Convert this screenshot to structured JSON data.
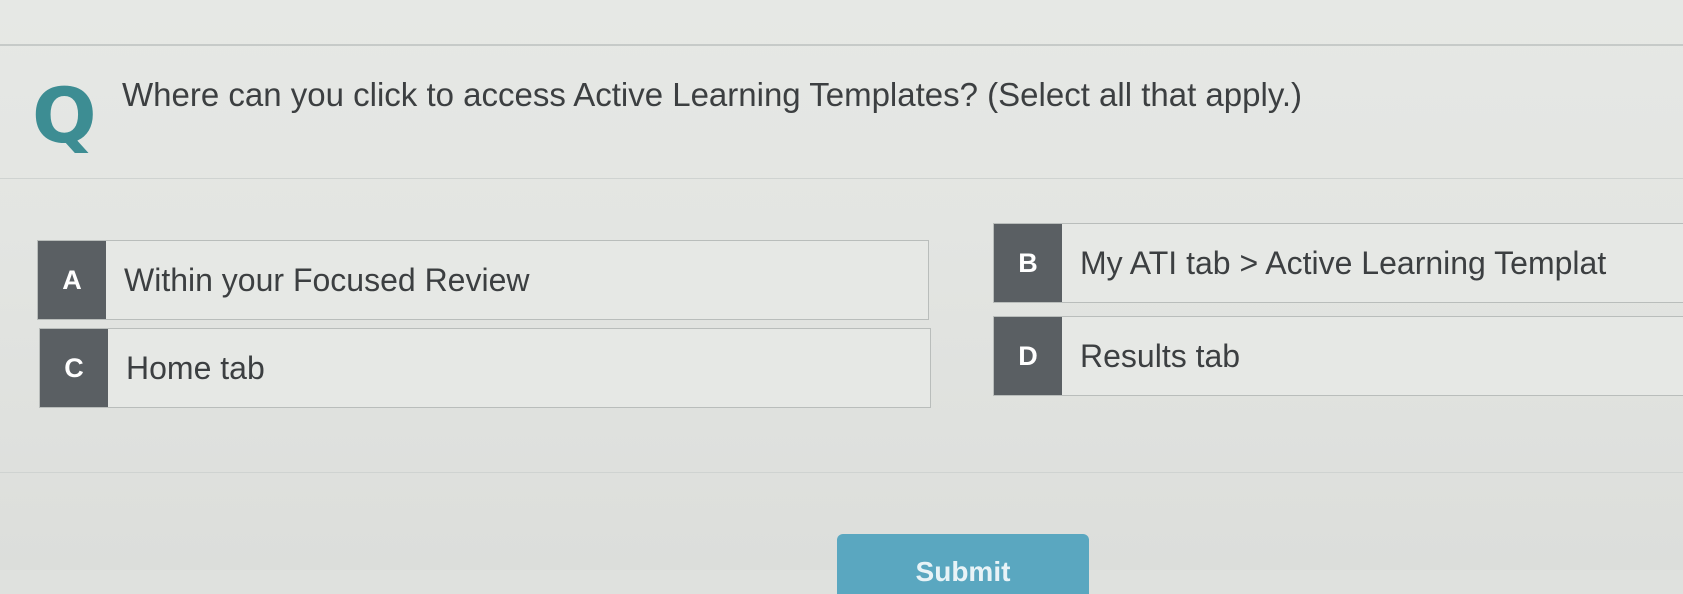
{
  "question": {
    "icon_glyph": "Q",
    "icon": "question-q-icon",
    "text": "Where can you click to access Active Learning Templates? (Select all that apply.)"
  },
  "options": [
    {
      "letter": "A",
      "text": "Within your Focused Review"
    },
    {
      "letter": "B",
      "text": "My ATI tab > Active Learning Templat"
    },
    {
      "letter": "C",
      "text": "Home tab"
    },
    {
      "letter": "D",
      "text": "Results tab"
    }
  ],
  "submit": {
    "label": "Submit"
  },
  "colors": {
    "accent": "#3d8d93",
    "letter_badge": "#5a5f63",
    "submit_button": "#5aa7c0",
    "background": "#e3e5e2"
  }
}
